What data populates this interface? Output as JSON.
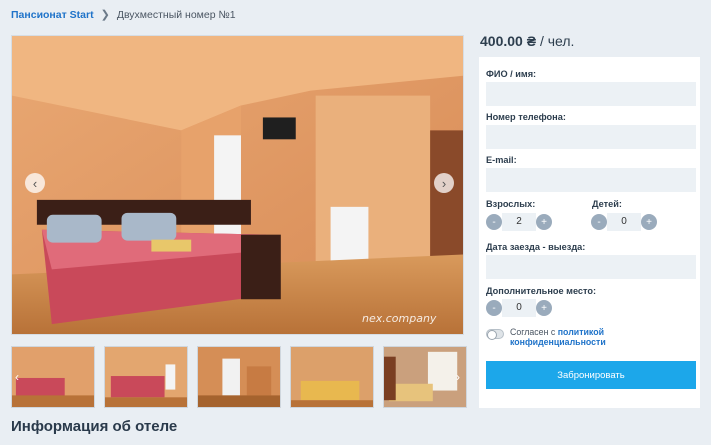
{
  "breadcrumb": {
    "home": "Пансионат Start",
    "current": "Двухместный номер №1"
  },
  "gallery": {
    "watermark": "nex.company",
    "prev_icon": "chevron-left-icon",
    "next_icon": "chevron-right-icon"
  },
  "section_title": "Информация об отеле",
  "price": {
    "amount": "400.00 ₴",
    "unit": " / чел."
  },
  "form": {
    "name_label": "ФИО / имя:",
    "phone_label": "Номер телефона:",
    "email_label": "E-mail:",
    "adults_label": "Взрослых:",
    "adults_value": "2",
    "children_label": "Детей:",
    "children_value": "0",
    "dates_label": "Дата заезда - выезда:",
    "extra_label": "Дополнительное место:",
    "extra_value": "0",
    "minus": "-",
    "plus": "+",
    "consent_text": "Согласен с ",
    "consent_link": "политикой конфиденциальности",
    "submit_label": "Забронировать"
  }
}
